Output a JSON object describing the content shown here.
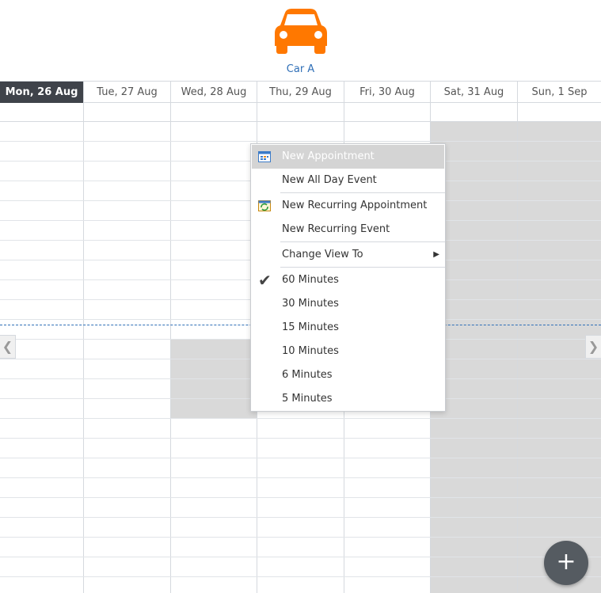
{
  "resource": {
    "name": "Car A",
    "icon": "car-icon",
    "icon_color": "#ff7800"
  },
  "days": [
    {
      "label": "Mon, 26 Aug"
    },
    {
      "label": "Tue, 27 Aug"
    },
    {
      "label": "Wed, 28 Aug"
    },
    {
      "label": "Thu, 29 Aug"
    },
    {
      "label": "Fri, 30 Aug"
    },
    {
      "label": "Sat, 31 Aug"
    },
    {
      "label": "Sun, 1 Sep"
    }
  ],
  "navigation": {
    "prev_icon": "chevron-left-icon",
    "next_icon": "chevron-right-icon",
    "prev_glyph": "❮",
    "next_glyph": "❯"
  },
  "context_menu": {
    "items": [
      {
        "label": "New Appointment",
        "icon": "calendar-icon"
      },
      {
        "label": "New All Day Event"
      },
      {
        "label": "New Recurring Appointment",
        "icon": "recurring-calendar-icon"
      },
      {
        "label": "New Recurring Event"
      },
      {
        "label": "Change View To",
        "submenu_arrow": "▶"
      },
      {
        "label": "60 Minutes",
        "checked": true,
        "check_glyph": "✔"
      },
      {
        "label": "30 Minutes"
      },
      {
        "label": "15 Minutes"
      },
      {
        "label": "10 Minutes"
      },
      {
        "label": "6 Minutes"
      },
      {
        "label": "5 Minutes"
      }
    ]
  },
  "fab": {
    "glyph": "+",
    "icon": "add-icon"
  },
  "colors": {
    "active_day_bg": "#3f434a",
    "weekend_bg": "#d9d9d9",
    "now_line": "#2f6fb7",
    "link": "#2f6fb7"
  }
}
